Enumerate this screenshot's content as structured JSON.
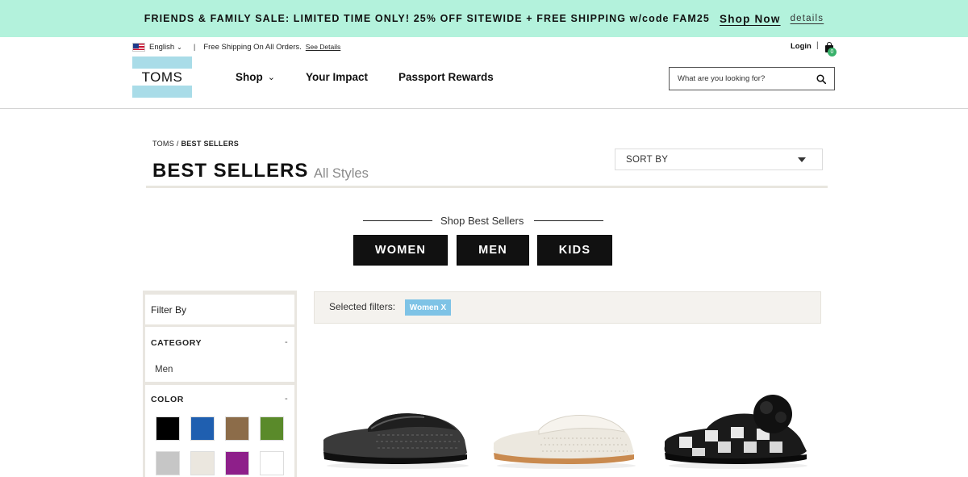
{
  "promo": {
    "text": "FRIENDS & FAMILY SALE: LIMITED TIME ONLY! 25% OFF SITEWIDE + FREE SHIPPING w/code FAM25",
    "shop_now": "Shop Now",
    "details": "details",
    "background_color": "#b3f2dc"
  },
  "utility": {
    "language": "English",
    "shipping_note": "Free Shipping On All Orders.",
    "see_details": "See Details",
    "login": "Login",
    "login_separator": "|",
    "cart_count": "0",
    "flag_icon": "us-flag-icon",
    "cart_icon": "shopping-bag-icon"
  },
  "logo": {
    "text": "TOMS",
    "color": "#a9dce8"
  },
  "nav": {
    "items": [
      {
        "label": "Shop"
      },
      {
        "label": "Your Impact"
      },
      {
        "label": "Passport Rewards"
      }
    ]
  },
  "search": {
    "placeholder": "What are you looking for?",
    "icon": "search-icon"
  },
  "breadcrumb": {
    "root": "TOMS",
    "separator": " / ",
    "current": "BEST SELLERS"
  },
  "page": {
    "title": "BEST SELLERS",
    "subtitle": "All Styles"
  },
  "sort": {
    "label": "SORT BY"
  },
  "shop_best_sellers": {
    "title": "Shop Best Sellers",
    "buttons": [
      {
        "label": "WOMEN"
      },
      {
        "label": "MEN"
      },
      {
        "label": "KIDS"
      }
    ]
  },
  "sidebar": {
    "filter_by": "Filter By",
    "sections": [
      {
        "title": "CATEGORY",
        "toggle": "-",
        "options": [
          "Men"
        ]
      },
      {
        "title": "COLOR",
        "toggle": "-"
      }
    ],
    "swatches": [
      {
        "name": "black",
        "color": "#000000"
      },
      {
        "name": "blue",
        "color": "#1f5fb0"
      },
      {
        "name": "brown",
        "color": "#8c6c49"
      },
      {
        "name": "green",
        "color": "#5a8a2a"
      },
      {
        "name": "grey",
        "color": "#c6c6c6"
      },
      {
        "name": "natural",
        "color": "#ebe7df"
      },
      {
        "name": "purple",
        "color": "#8e1f8a"
      },
      {
        "name": "white",
        "color": "#ffffff"
      }
    ]
  },
  "selected_filters": {
    "label": "Selected filters:",
    "chips": [
      {
        "label": "Women X",
        "color": "#7ec3e6"
      }
    ]
  },
  "products": [
    {
      "name": "grey-knit-slipper",
      "image": "slipper-image"
    },
    {
      "name": "cream-knit-slipper",
      "image": "slipper-image"
    },
    {
      "name": "plaid-pom-pom-slipper",
      "image": "slipper-image"
    }
  ]
}
